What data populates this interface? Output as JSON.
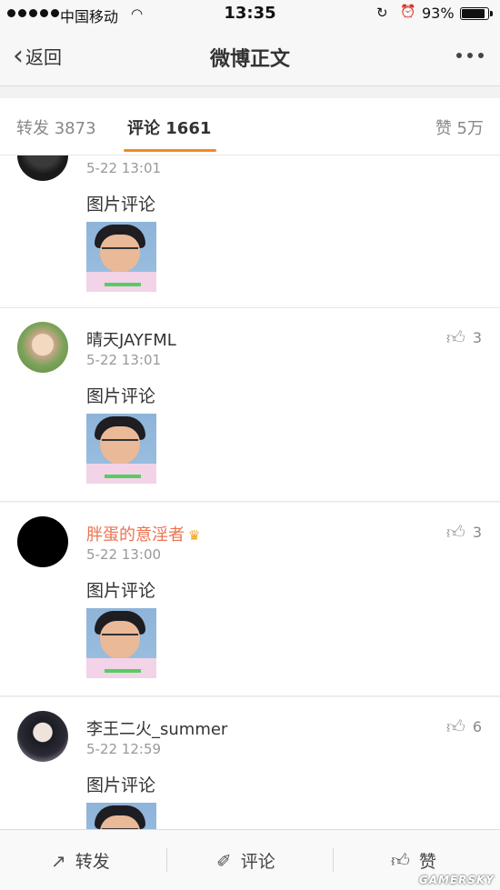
{
  "status_bar": {
    "carrier": "中国移动",
    "time": "13:35",
    "battery_percent": "93%",
    "battery_level": 0.93
  },
  "nav": {
    "back_label": "返回",
    "title": "微博正文"
  },
  "tabs": {
    "repost": "转发 3873",
    "comment": "评论 1661",
    "like": "赞 5万"
  },
  "comments": [
    {
      "username": "",
      "time": "5-22 13:01",
      "text": "图片评论",
      "likes": ""
    },
    {
      "username": "晴天JAYFML",
      "time": "5-22 13:01",
      "text": "图片评论",
      "likes": "3"
    },
    {
      "username": "胖蛋的意淫者",
      "time": "5-22 13:00",
      "text": "图片评论",
      "likes": "3"
    },
    {
      "username": "李王二火_summer",
      "time": "5-22 12:59",
      "text": "图片评论",
      "likes": "6"
    }
  ],
  "toolbar": {
    "repost": "转发",
    "comment": "评论",
    "like": "赞"
  },
  "watermark": "GAMERSKY",
  "icons": {
    "back": "chevron-left-icon",
    "more": "more-dots-icon",
    "thumb": "thumbs-up-icon",
    "repost": "repost-icon",
    "comment": "comment-icon"
  },
  "colors": {
    "accent": "#f08a24",
    "vip_name": "#eb7350"
  }
}
